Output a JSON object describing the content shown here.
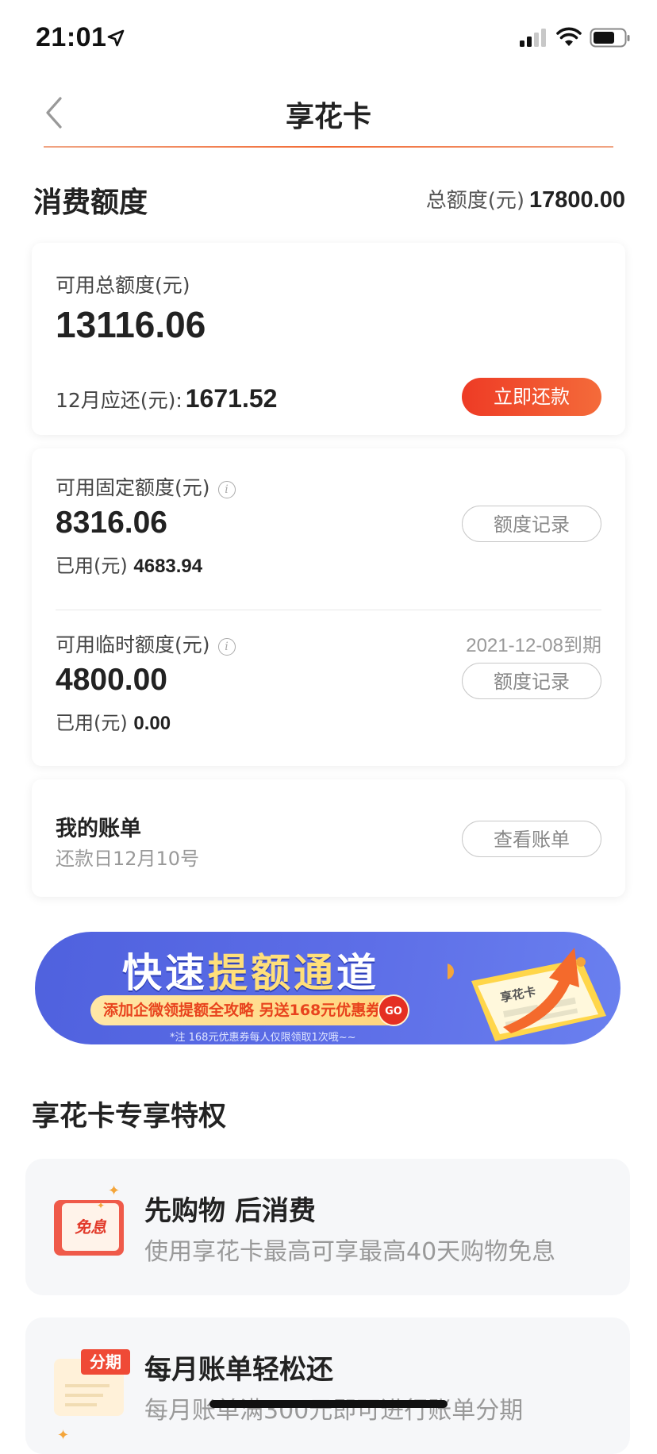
{
  "status_bar": {
    "time": "21:01"
  },
  "nav": {
    "title": "享花卡",
    "back_icon": "chevron-left-icon"
  },
  "section": {
    "title": "消费额度",
    "total_label": "总额度(元)",
    "total_value": "17800.00"
  },
  "summary_card": {
    "available_label": "可用总额度(元)",
    "available_value": "13116.06",
    "due_label": "12月应还(元):",
    "due_value": "1671.52",
    "pay_button": "立即还款"
  },
  "fixed_limit": {
    "label": "可用固定额度(元)",
    "value": "8316.06",
    "used_label": "已用(元)",
    "used_value": "4683.94",
    "record_button": "额度记录"
  },
  "temp_limit": {
    "label": "可用临时额度(元)",
    "value": "4800.00",
    "used_label": "已用(元)",
    "used_value": "0.00",
    "expire": "2021-12-08到期",
    "record_button": "额度记录"
  },
  "bill": {
    "title": "我的账单",
    "subtitle": "还款日12月10号",
    "button": "查看账单"
  },
  "banner": {
    "title_parts": [
      "快速",
      "提",
      "额",
      "通",
      "道"
    ],
    "pill_text": "添加企微领提额全攻略 另送168元优惠券",
    "go": "GO",
    "note": "*注  168元优惠券每人仅限领取1次哦~~",
    "card_text": "享花卡"
  },
  "privileges": {
    "title": "享花卡专享特权",
    "items": [
      {
        "name": "先购物 后消费",
        "desc": "使用享花卡最高可享最高40天购物免息",
        "icon_text": "免息"
      },
      {
        "name": "每月账单轻松还",
        "desc": "每月账单满300元即可进行账单分期",
        "icon_text": "分期"
      }
    ]
  },
  "colors": {
    "accent_red": "#ee3b25",
    "banner_blue": "#5d6ee7",
    "muted_text": "#999999"
  }
}
